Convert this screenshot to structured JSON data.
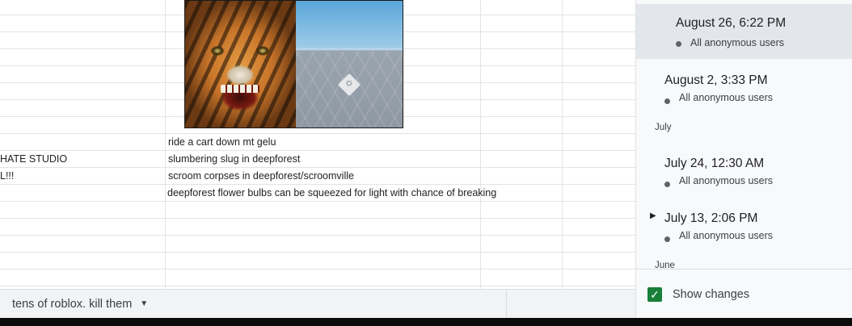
{
  "sheet": {
    "rows": [
      {
        "col_a": "",
        "col_b": "ride a cart down mt gelu"
      },
      {
        "col_a": "HATE STUDIO",
        "col_b": "slumbering slug in deepforest"
      },
      {
        "col_a": "L!!!",
        "col_b": "scroom corpses in deepforest/scroomville"
      },
      {
        "col_a": "",
        "col_b": "deepforest flower bulbs can be squeezed for light with chance of breaking"
      }
    ],
    "tab_label": "tens of roblox. kill them",
    "tab_caret_icon": "caret-down-icon"
  },
  "history": {
    "versions": [
      {
        "time": "August 26, 6:22 PM",
        "user": "All anonymous users",
        "selected": true
      },
      {
        "time": "August 2, 3:33 PM",
        "user": "All anonymous users",
        "selected": false
      },
      {
        "time": "July 24, 12:30 AM",
        "user": "All anonymous users",
        "selected": false
      },
      {
        "time": "July 13, 2:06 PM",
        "user": "All anonymous users",
        "selected": false
      }
    ],
    "months": [
      "July",
      "June"
    ],
    "show_changes_label": "Show changes",
    "show_changes_checked": true
  },
  "colors": {
    "selected_version_bg": "#e3e6ea",
    "checkbox_green": "#188038",
    "grid_line": "#e2e3e3"
  }
}
